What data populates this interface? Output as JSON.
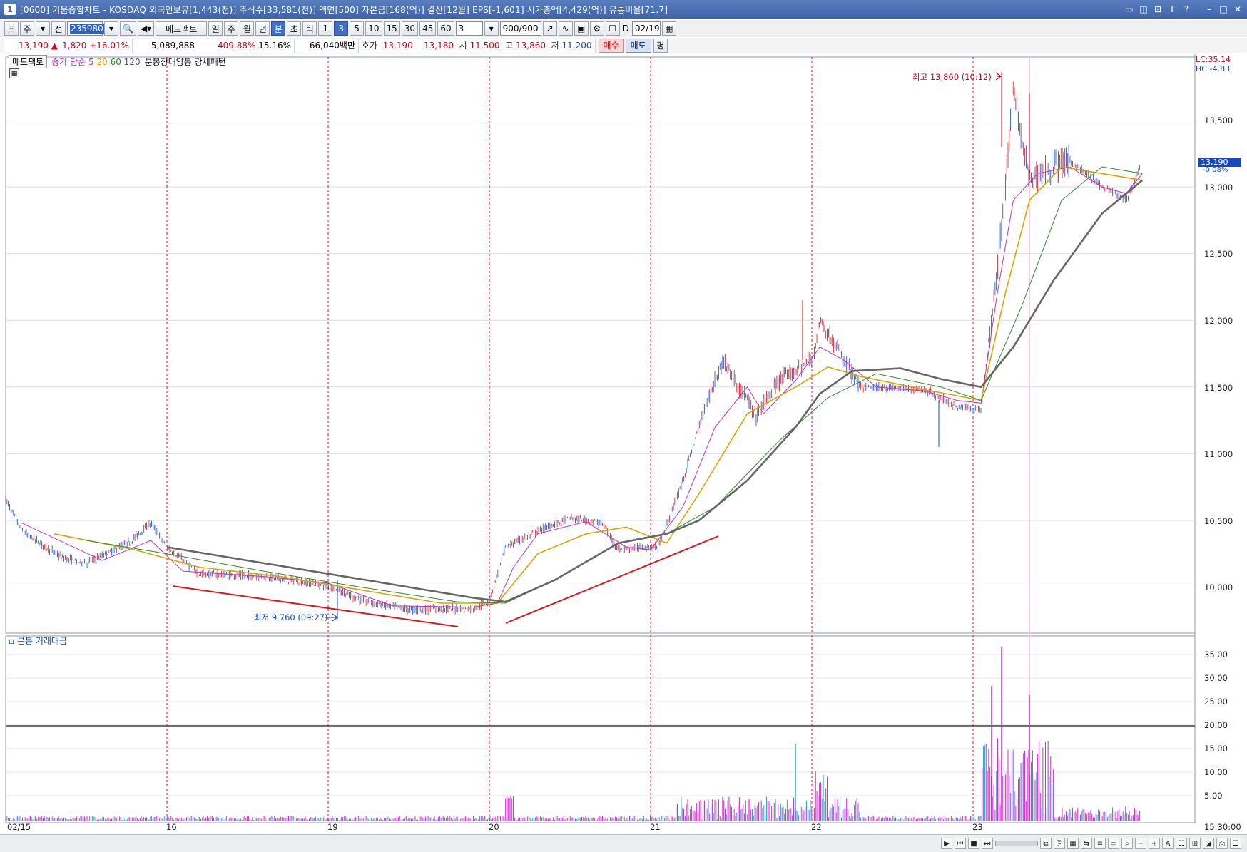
{
  "window": {
    "icon_label": "1",
    "title": "[0600] 키움종합차트 - KOSDAQ 외국인보유[1,443(천)] 주식수[33,581(천)] 액면[500] 자본금[168(억)] 결산[12월] EPS[-1,601] 시가총액[4,429(억)] 유통비율[71.7]"
  },
  "toolbar": {
    "market": "주",
    "all_label": "전",
    "code": "235980",
    "indicator_button": "메드팩토",
    "period_tabs": [
      "일",
      "주",
      "월",
      "년",
      "분",
      "초",
      "틱"
    ],
    "active_period": "분",
    "minute_options": [
      "1",
      "3",
      "5",
      "10",
      "15",
      "30",
      "45",
      "60"
    ],
    "active_minute": "3",
    "custom_minute": "3",
    "count": "900/900",
    "date_checkbox": "D",
    "date": "02/19"
  },
  "quote": {
    "price": "13,190",
    "change": "1,820",
    "change_pct": "+16.01%",
    "volume": "5,089,888",
    "volume_ratio": "409.88%",
    "turnover": "15.16%",
    "trade_value": "66,040백만",
    "bid_label": "호가",
    "ask": "13,190",
    "bid": "13,180",
    "open_label": "시",
    "open": "11,500",
    "high_label": "고",
    "high": "13,860",
    "low_label": "저",
    "low": "11,200",
    "buy_button": "매수",
    "sell_button": "매도",
    "avg_button": "평"
  },
  "legend": {
    "stock": "메드팩토",
    "ma_label": "종가 단순",
    "ma5": "5",
    "ma20": "20",
    "ma60": "60",
    "ma120": "120",
    "pattern": "분봉장대양봉 강세패턴"
  },
  "labels": {
    "lc": "LC:35.14",
    "hc": "HC:-4.83",
    "current_price": "13,190",
    "current_pct": "-0.08%",
    "high_annotation": "최고 13,860 (10:12)",
    "low_annotation": "최저 9,760 (09:27)",
    "volume_panel": "분봉 거래대금",
    "time": "15:30:00"
  },
  "colors": {
    "ma5": "#c033c0",
    "ma20": "#e0a200",
    "ma60": "#2c8a2c",
    "ma120": "#666666",
    "trendline": "#e0151b",
    "day_divider": "#e0151b",
    "volume_up": "#d22ad2",
    "volume_down": "#29a6c4",
    "title_bar": "#3e63a8"
  },
  "chart_data": {
    "type": "line",
    "x": [
      "02/15",
      "16",
      "19",
      "20",
      "21",
      "22",
      "23"
    ],
    "y_ticks": [
      "13,500",
      "13,000",
      "12,500",
      "12,000",
      "11,500",
      "11,000",
      "10,500",
      "10,000"
    ],
    "volume_ticks": [
      "35.00",
      "30.00",
      "25.00",
      "20.00",
      "15.00",
      "10.00",
      "5.00"
    ],
    "ylim": [
      9600,
      14000
    ],
    "price_series": {
      "name": "메드팩토",
      "points": [
        [
          0,
          10660
        ],
        [
          0.1,
          10420
        ],
        [
          0.35,
          10220
        ],
        [
          0.5,
          10180
        ],
        [
          0.75,
          10320
        ],
        [
          0.9,
          10480
        ],
        [
          1,
          10300
        ],
        [
          1.2,
          10100
        ],
        [
          1.6,
          10080
        ],
        [
          2,
          10010
        ],
        [
          2.2,
          9900
        ],
        [
          2.5,
          9830
        ],
        [
          2.9,
          9840
        ],
        [
          3,
          9900
        ],
        [
          3.1,
          10300
        ],
        [
          3.3,
          10420
        ],
        [
          3.5,
          10520
        ],
        [
          3.7,
          10480
        ],
        [
          3.8,
          10280
        ],
        [
          3.95,
          10300
        ],
        [
          4.05,
          10300
        ],
        [
          4.2,
          10800
        ],
        [
          4.35,
          11400
        ],
        [
          4.45,
          11700
        ],
        [
          4.6,
          11400
        ],
        [
          4.65,
          11280
        ],
        [
          4.8,
          11550
        ],
        [
          5,
          11700
        ],
        [
          5.05,
          12000
        ],
        [
          5.15,
          11800
        ],
        [
          5.3,
          11500
        ],
        [
          5.7,
          11480
        ],
        [
          5.9,
          11350
        ],
        [
          6.05,
          11330
        ],
        [
          6.15,
          12400
        ],
        [
          6.2,
          13000
        ],
        [
          6.25,
          13700
        ],
        [
          6.35,
          13050
        ],
        [
          6.5,
          13150
        ],
        [
          6.6,
          13200
        ],
        [
          6.8,
          13000
        ],
        [
          6.95,
          12900
        ],
        [
          7.05,
          13190
        ]
      ]
    },
    "ma_points": {
      "ma5": [
        [
          0.1,
          10480
        ],
        [
          0.6,
          10200
        ],
        [
          0.9,
          10350
        ],
        [
          1.1,
          10120
        ],
        [
          1.6,
          10080
        ],
        [
          2,
          10030
        ],
        [
          2.4,
          9860
        ],
        [
          2.9,
          9850
        ],
        [
          3.05,
          9880
        ],
        [
          3.15,
          10150
        ],
        [
          3.3,
          10400
        ],
        [
          3.6,
          10490
        ],
        [
          3.85,
          10300
        ],
        [
          4,
          10280
        ],
        [
          4.2,
          10600
        ],
        [
          4.4,
          11200
        ],
        [
          4.6,
          11500
        ],
        [
          4.7,
          11300
        ],
        [
          4.9,
          11550
        ],
        [
          5.05,
          11800
        ],
        [
          5.2,
          11700
        ],
        [
          5.4,
          11500
        ],
        [
          5.7,
          11470
        ],
        [
          5.9,
          11400
        ],
        [
          6.05,
          11380
        ],
        [
          6.15,
          12200
        ],
        [
          6.25,
          12900
        ],
        [
          6.4,
          13100
        ],
        [
          6.6,
          13150
        ],
        [
          6.8,
          13000
        ],
        [
          6.95,
          12950
        ],
        [
          7.05,
          13100
        ]
      ],
      "ma20": [
        [
          0.3,
          10400
        ],
        [
          0.8,
          10280
        ],
        [
          1.2,
          10150
        ],
        [
          1.7,
          10080
        ],
        [
          2.2,
          9980
        ],
        [
          2.7,
          9880
        ],
        [
          3.05,
          9880
        ],
        [
          3.3,
          10250
        ],
        [
          3.6,
          10400
        ],
        [
          3.85,
          10450
        ],
        [
          4.1,
          10330
        ],
        [
          4.3,
          10700
        ],
        [
          4.6,
          11300
        ],
        [
          4.9,
          11500
        ],
        [
          5.1,
          11650
        ],
        [
          5.3,
          11580
        ],
        [
          5.7,
          11480
        ],
        [
          6.05,
          11400
        ],
        [
          6.2,
          12200
        ],
        [
          6.35,
          12900
        ],
        [
          6.55,
          13150
        ],
        [
          6.8,
          13100
        ],
        [
          7.05,
          13050
        ]
      ],
      "ma60": [
        [
          0.5,
          10350
        ],
        [
          1,
          10250
        ],
        [
          1.6,
          10120
        ],
        [
          2.2,
          10000
        ],
        [
          2.8,
          9890
        ],
        [
          3.1,
          9880
        ],
        [
          3.4,
          10050
        ],
        [
          3.8,
          10330
        ],
        [
          4.1,
          10400
        ],
        [
          4.4,
          10600
        ],
        [
          4.8,
          11100
        ],
        [
          5.1,
          11420
        ],
        [
          5.4,
          11600
        ],
        [
          5.8,
          11500
        ],
        [
          6.05,
          11400
        ],
        [
          6.3,
          12100
        ],
        [
          6.55,
          12900
        ],
        [
          6.8,
          13150
        ],
        [
          7.05,
          13100
        ]
      ],
      "ma120": [
        [
          1,
          10300
        ],
        [
          1.5,
          10200
        ],
        [
          2,
          10100
        ],
        [
          2.5,
          10000
        ],
        [
          2.9,
          9920
        ],
        [
          3.1,
          9890
        ],
        [
          3.4,
          10050
        ],
        [
          3.8,
          10330
        ],
        [
          4.1,
          10400
        ],
        [
          4.3,
          10500
        ],
        [
          4.6,
          10800
        ],
        [
          4.9,
          11200
        ],
        [
          5.05,
          11450
        ],
        [
          5.25,
          11620
        ],
        [
          5.55,
          11640
        ],
        [
          5.8,
          11560
        ],
        [
          6.05,
          11500
        ],
        [
          6.25,
          11800
        ],
        [
          6.5,
          12300
        ],
        [
          6.8,
          12800
        ],
        [
          7.05,
          13050
        ]
      ]
    }
  }
}
